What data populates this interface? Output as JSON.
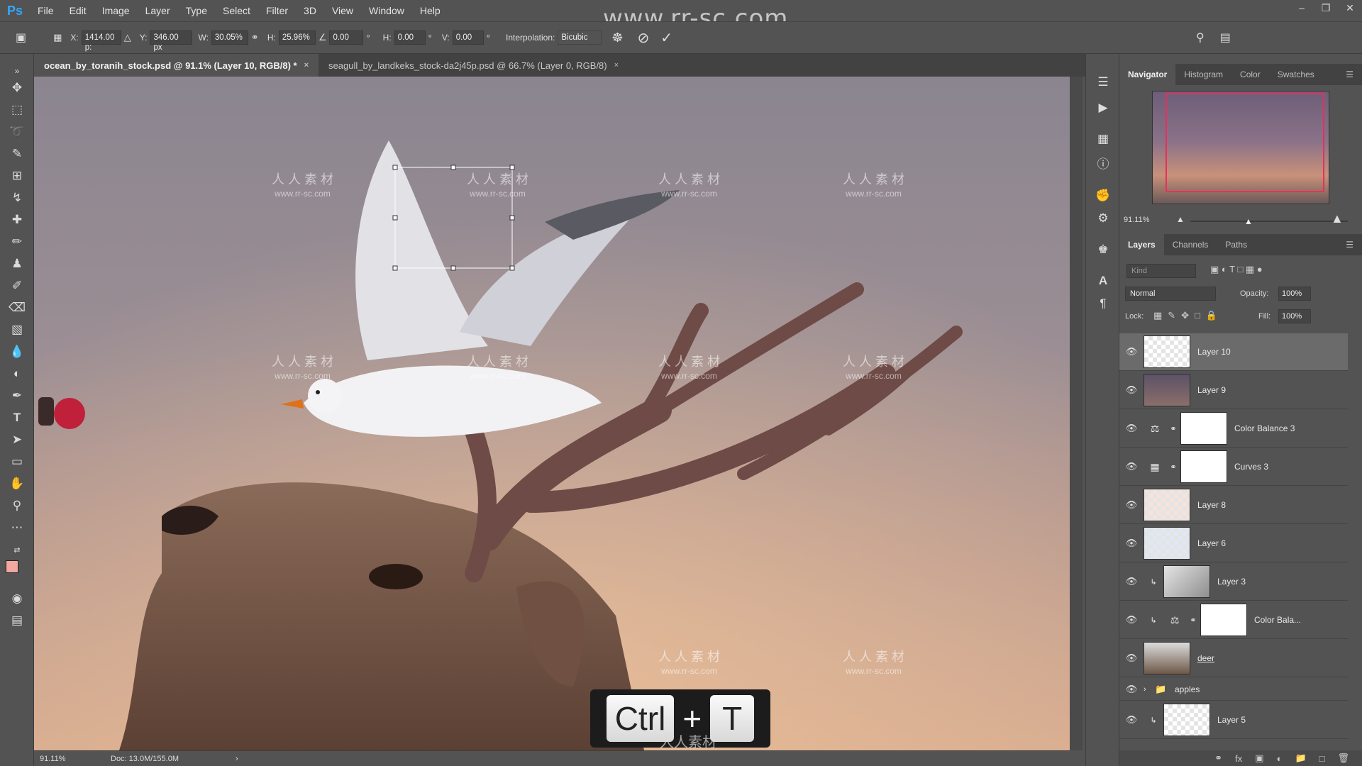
{
  "app": {
    "logo": "Ps",
    "watermark_top": "www.rr-sc.com",
    "menu": [
      "File",
      "Edit",
      "Image",
      "Layer",
      "Type",
      "Select",
      "Filter",
      "3D",
      "View",
      "Window",
      "Help"
    ]
  },
  "options_bar": {
    "x_label": "X:",
    "x_value": "1414.00 p:",
    "y_label": "Y:",
    "y_value": "346.00 px",
    "w_label": "W:",
    "w_value": "30.05%",
    "h_label": "H:",
    "h_value": "25.96%",
    "angle_value": "0.00",
    "angle_unit": "°",
    "hskew_label": "H:",
    "hskew_value": "0.00",
    "hskew_unit": "°",
    "vskew_label": "V:",
    "vskew_value": "0.00",
    "vskew_unit": "°",
    "interpolation_label": "Interpolation:",
    "interpolation_value": "Bicubic"
  },
  "tabs": [
    {
      "label": "ocean_by_toranih_stock.psd @ 91.1% (Layer 10, RGB/8) *",
      "close": "×"
    },
    {
      "label": "seagull_by_landkeks_stock-da2j45p.psd @ 66.7% (Layer 0, RGB/8)",
      "close": "×"
    }
  ],
  "status": {
    "zoom": "91.11%",
    "doc": "Doc: 13.0M/155.0M"
  },
  "canvas_watermarks": [
    {
      "cn": "人 人 素 材",
      "url": "www.rr-sc.com"
    }
  ],
  "key_overlay": {
    "key1": "Ctrl",
    "plus": "+",
    "key2": "T",
    "watermark": "人人素材"
  },
  "navigator": {
    "tabs": [
      "Navigator",
      "Histogram",
      "Color",
      "Swatches"
    ],
    "zoom": "91.11%"
  },
  "layers_panel": {
    "tabs": [
      "Layers",
      "Channels",
      "Paths"
    ],
    "filter_placeholder": "Kind",
    "blend_mode": "Normal",
    "opacity_label": "Opacity:",
    "opacity_value": "100%",
    "lock_label": "Lock:",
    "fill_label": "Fill:",
    "fill_value": "100%",
    "layers": [
      {
        "name": "Layer 10",
        "selected": true
      },
      {
        "name": "Layer 9"
      },
      {
        "name": "Color Balance 3"
      },
      {
        "name": "Curves 3"
      },
      {
        "name": "Layer 8"
      },
      {
        "name": "Layer 6"
      },
      {
        "name": "Layer 3"
      },
      {
        "name": "Color Bala..."
      },
      {
        "name": "deer"
      },
      {
        "name": "apples"
      },
      {
        "name": "Layer 5"
      }
    ]
  },
  "colors": {
    "accent": "#31a8ff",
    "nav_view": "#e8305a",
    "panel_bg": "#535353"
  }
}
